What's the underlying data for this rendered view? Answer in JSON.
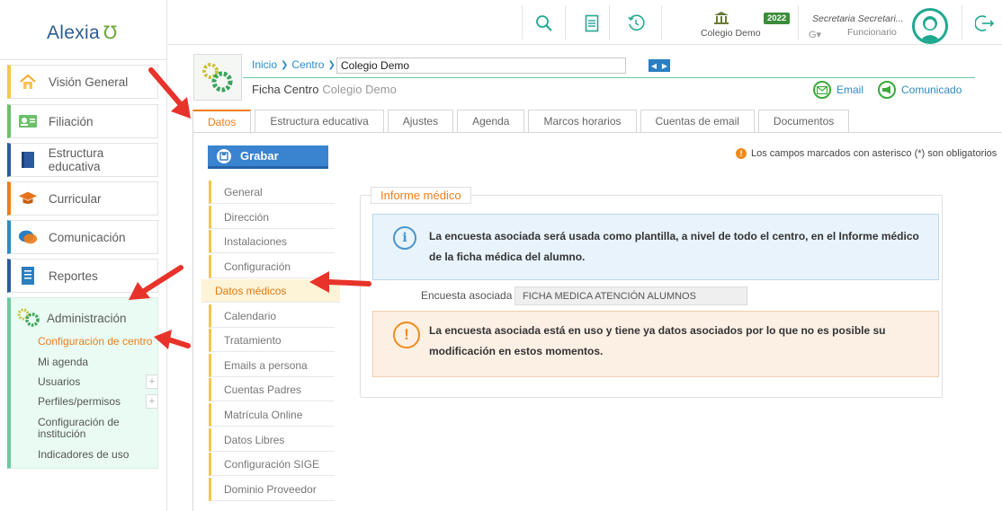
{
  "app": {
    "logo_text": "Alexia"
  },
  "sidebar": {
    "items": [
      {
        "label": "Visión General",
        "icon": "house-icon"
      },
      {
        "label": "Filiación",
        "icon": "id-card-icon"
      },
      {
        "label": "Estructura educativa",
        "icon": "book-icon"
      },
      {
        "label": "Curricular",
        "icon": "graduation-cap-icon"
      },
      {
        "label": "Comunicación",
        "icon": "chat-bubbles-icon"
      },
      {
        "label": "Reportes",
        "icon": "report-document-icon"
      }
    ],
    "admin": {
      "label": "Administración",
      "icon": "gears-icon",
      "subitems": [
        {
          "label": "Configuración de centro",
          "active": true
        },
        {
          "label": "Mi agenda"
        },
        {
          "label": "Usuarios",
          "expand": "+"
        },
        {
          "label": "Perfiles/permisos",
          "expand": "+"
        },
        {
          "label": "Configuración de institución"
        },
        {
          "label": "Indicadores de uso"
        }
      ]
    }
  },
  "topbar": {
    "centro_name": "Colegio Demo",
    "year_badge": "2022",
    "user_name": "Secretaria Secretari...",
    "user_role": "Funcionario",
    "user_g": "G▾"
  },
  "header": {
    "breadcrumb": [
      "Inicio",
      "Centro"
    ],
    "centro_input": "Colegio Demo",
    "title": "Ficha Centro",
    "title_sub": "Colegio Demo",
    "actions": {
      "email": "Email",
      "comunicado": "Comunicado"
    }
  },
  "tabs": [
    {
      "label": "Datos",
      "active": true
    },
    {
      "label": "Estructura educativa"
    },
    {
      "label": "Ajustes"
    },
    {
      "label": "Agenda"
    },
    {
      "label": "Marcos horarios"
    },
    {
      "label": "Cuentas de email"
    },
    {
      "label": "Documentos"
    }
  ],
  "toolbar": {
    "save_label": "Grabar"
  },
  "mandatory_note": "Los campos marcados con asterisco (*) son obligatorios",
  "submenu": [
    {
      "label": "General"
    },
    {
      "label": "Dirección"
    },
    {
      "label": "Instalaciones"
    },
    {
      "label": "Configuración"
    },
    {
      "label": "Datos médicos",
      "active": true
    },
    {
      "label": "Calendario"
    },
    {
      "label": "Tratamiento"
    },
    {
      "label": "Emails a persona"
    },
    {
      "label": "Cuentas Padres"
    },
    {
      "label": "Matrícula Online"
    },
    {
      "label": "Datos Libres"
    },
    {
      "label": "Configuración SIGE"
    },
    {
      "label": "Dominio Proveedor"
    }
  ],
  "informe": {
    "legend": "Informe médico",
    "info_text": "La encuesta asociada será usada como plantilla, a nivel de todo el centro, en el Informe médico de la ficha médica del alumno.",
    "encuesta_label": "Encuesta asociada :",
    "encuesta_value": "FICHA MEDICA ATENCIÓN ALUMNOS",
    "warning_text": "La encuesta asociada está en uso y tiene ya datos asociados por lo que no es posible su modificación en estos momentos."
  },
  "colors": {
    "accent": "#f07d1a",
    "link": "#2b8cc4",
    "admin_bg": "#e9fbf2",
    "arrow": "#e8332a"
  }
}
